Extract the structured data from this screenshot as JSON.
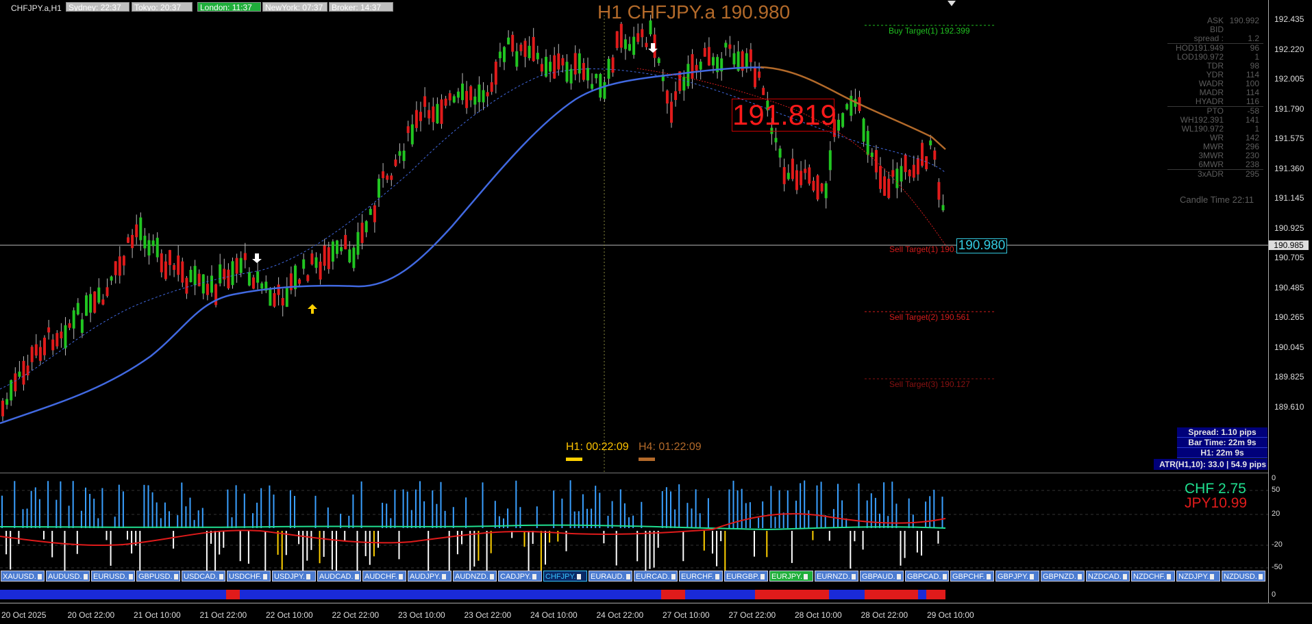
{
  "window": {
    "symbol_label": "CHFJPY.a,H1"
  },
  "sessions": [
    {
      "label": "Sydney: 22:37",
      "active": false
    },
    {
      "label": "Tokyo: 20:37",
      "active": false
    },
    {
      "label": "London: 11:37",
      "active": true
    },
    {
      "label": "NewYork: 07:37",
      "active": false
    },
    {
      "label": "Broker: 14:37",
      "active": false
    }
  ],
  "chart_title": "H1 CHFJPY.a 190.980",
  "price_axis": {
    "ticks": [
      "192.435",
      "192.220",
      "192.005",
      "191.790",
      "191.575",
      "191.360",
      "191.145",
      "190.925",
      "190.705",
      "190.485",
      "190.265",
      "190.045",
      "189.825",
      "189.610"
    ],
    "current": "190.985"
  },
  "info_panel": [
    {
      "k": "ASK",
      "v": "190.992"
    },
    {
      "k": "BID",
      "v": ""
    },
    {
      "k": "spread :",
      "v": "1.2"
    },
    {
      "k": "HOD191.949",
      "v": "96"
    },
    {
      "k": "LOD190.972",
      "v": "1"
    },
    {
      "k": "TDR",
      "v": "98"
    },
    {
      "k": "YDR",
      "v": "114"
    },
    {
      "k": "WADR",
      "v": "100"
    },
    {
      "k": "MADR",
      "v": "114"
    },
    {
      "k": "HYADR",
      "v": "116"
    },
    {
      "k": "PTO",
      "v": "-58"
    },
    {
      "k": "WH192.391",
      "v": "141"
    },
    {
      "k": "WL190.972",
      "v": "1"
    },
    {
      "k": "WR",
      "v": "142"
    },
    {
      "k": "MWR",
      "v": "296"
    },
    {
      "k": "3MWR",
      "v": "230"
    },
    {
      "k": "6MWR",
      "v": "238"
    },
    {
      "k": "3xADR",
      "v": "295"
    }
  ],
  "candle_time": "Candle Time  22:11",
  "big_price": "191.819",
  "current_price_box": "190.980",
  "targets": {
    "buy1": "Buy Target(1) 192.399",
    "sell1": "Sell Target(1) 190.980",
    "sell2": "Sell Target(2) 190.561",
    "sell3": "Sell Target(3) 190.127"
  },
  "timers": {
    "h1": "H1:  00:22:09",
    "h4": "H4:  01:22:09"
  },
  "spread_box": {
    "spread": "Spread: 1.10 pips",
    "bar_time": "Bar Time: 22m 9s",
    "h1": "H1:  22m 9s",
    "atr": "ATR(H1,10): 33.0  |  54.9 pips"
  },
  "strength": {
    "chf": "CHF 2.75",
    "jpy": "JPY10.99"
  },
  "sub_axis": [
    "0",
    "50",
    "20",
    "-20",
    "-50",
    "0"
  ],
  "symbols": [
    {
      "label": "XAUUSD.",
      "state": "normal"
    },
    {
      "label": "AUDUSD.",
      "state": "normal"
    },
    {
      "label": "EURUSD.",
      "state": "normal"
    },
    {
      "label": "GBPUSD.",
      "state": "normal"
    },
    {
      "label": "USDCAD.",
      "state": "normal"
    },
    {
      "label": "USDCHF.",
      "state": "normal"
    },
    {
      "label": "USDJPY.",
      "state": "normal"
    },
    {
      "label": "AUDCAD.",
      "state": "normal"
    },
    {
      "label": "AUDCHF.",
      "state": "normal"
    },
    {
      "label": "AUDJPY.",
      "state": "normal"
    },
    {
      "label": "AUDNZD.",
      "state": "normal"
    },
    {
      "label": "CADJPY.",
      "state": "normal"
    },
    {
      "label": "CHFJPY.",
      "state": "active"
    },
    {
      "label": "EURAUD.",
      "state": "normal"
    },
    {
      "label": "EURCAD.",
      "state": "normal"
    },
    {
      "label": "EURCHF.",
      "state": "normal"
    },
    {
      "label": "EURGBP.",
      "state": "normal"
    },
    {
      "label": "EURJPY.",
      "state": "green"
    },
    {
      "label": "EURNZD.",
      "state": "normal"
    },
    {
      "label": "GBPAUD.",
      "state": "normal"
    },
    {
      "label": "GBPCAD.",
      "state": "normal"
    },
    {
      "label": "GBPCHF.",
      "state": "normal"
    },
    {
      "label": "GBPJPY.",
      "state": "normal"
    },
    {
      "label": "GBPNZD.",
      "state": "normal"
    },
    {
      "label": "NZDCAD.",
      "state": "normal"
    },
    {
      "label": "NZDCHF.",
      "state": "normal"
    },
    {
      "label": "NZDJPY.",
      "state": "normal"
    },
    {
      "label": "NZDUSD.",
      "state": "normal"
    }
  ],
  "time_axis": [
    "20 Oct 2025",
    "20 Oct 22:00",
    "21 Oct 10:00",
    "21 Oct 22:00",
    "22 Oct 10:00",
    "22 Oct 22:00",
    "23 Oct 10:00",
    "23 Oct 22:00",
    "24 Oct 10:00",
    "24 Oct 22:00",
    "27 Oct 10:00",
    "27 Oct 22:00",
    "28 Oct 10:00",
    "28 Oct 22:00",
    "29 Oct 10:00"
  ],
  "colors": {
    "bull": "#21c521",
    "bear": "#e01b1b",
    "ma": "#4169e1",
    "ma_slow": "#b36a2a",
    "buy_target": "#20c020",
    "sell_target": "#d41c1c"
  },
  "icons": [
    "dropdown-arrow-icon",
    "down-arrow-signal-icon",
    "up-arrow-signal-icon"
  ]
}
